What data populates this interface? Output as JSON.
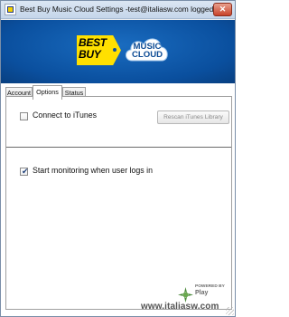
{
  "window": {
    "title": "Best Buy Music Cloud Settings -test@italiasw.com logged on",
    "close_glyph": "✕"
  },
  "banner": {
    "best_buy_logo_text": "BEST BUY",
    "music_cloud_logo_text": "MUSIC CLOUD",
    "background_color": "#0a4f9e",
    "tag_color": "#ffe000"
  },
  "tabs": [
    {
      "label": "Account",
      "active": false
    },
    {
      "label": "Options",
      "active": true
    },
    {
      "label": "Status",
      "active": false
    }
  ],
  "options": {
    "connect_itunes": {
      "label": "Connect to iTunes",
      "checked": false
    },
    "rescan_button": {
      "label": "Rescan iTunes Library",
      "enabled": false
    },
    "start_monitoring": {
      "label": "Start monitoring when user logs in",
      "checked": true
    },
    "check_glyph": "✔"
  },
  "watermark": {
    "powered_by": "POWERED BY",
    "play": "Play",
    "url": "www.italiasw.com"
  }
}
